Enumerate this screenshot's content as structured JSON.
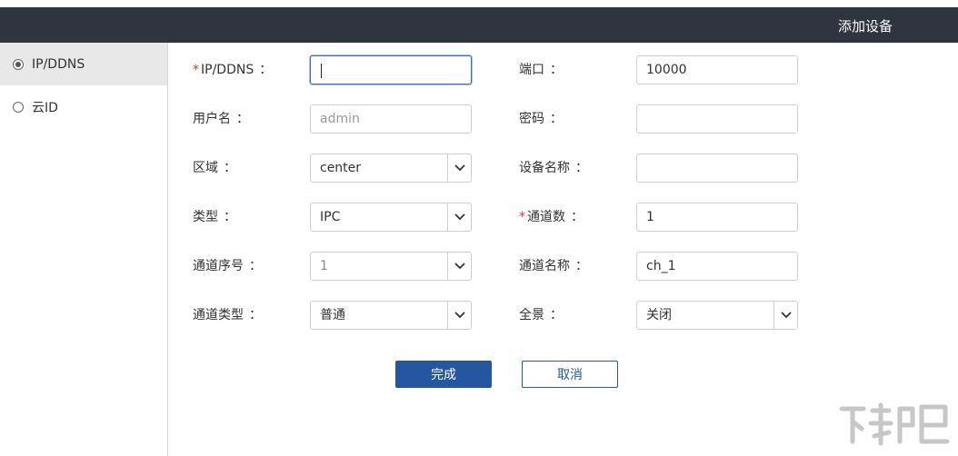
{
  "header": {
    "title": "添加设备"
  },
  "sidebar": {
    "items": [
      {
        "label": "IP/DDNS",
        "selected": true
      },
      {
        "label": "云ID",
        "selected": false
      }
    ]
  },
  "form": {
    "ip": {
      "label": "IP/DDNS",
      "value": ""
    },
    "port": {
      "label": "端口",
      "value": "10000"
    },
    "username": {
      "label": "用户名",
      "placeholder": "admin"
    },
    "password": {
      "label": "密码",
      "value": ""
    },
    "region": {
      "label": "区域",
      "value": "center"
    },
    "device_name": {
      "label": "设备名称",
      "value": ""
    },
    "type": {
      "label": "类型",
      "value": "IPC"
    },
    "channel_count": {
      "label": "通道数",
      "value": "1"
    },
    "channel_no": {
      "label": "通道序号",
      "value": "1"
    },
    "channel_name": {
      "label": "通道名称",
      "value": "ch_1"
    },
    "channel_type": {
      "label": "通道类型",
      "value": "普通"
    },
    "panorama": {
      "label": "全景",
      "value": "关闭"
    },
    "colon": "："
  },
  "buttons": {
    "finish": "完成",
    "cancel": "取消"
  },
  "colors": {
    "header_bg": "#2f3540",
    "primary": "#24579f",
    "required": "#d9383a",
    "sidebar_active": "#e8e8e8"
  },
  "icons": {
    "select_arrow": "chevron-down-icon",
    "radio": "radio-icon"
  }
}
